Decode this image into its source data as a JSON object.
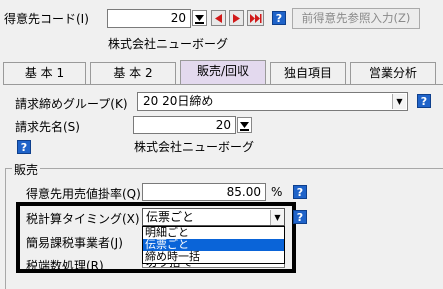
{
  "customer_code": {
    "label": "得意先コード(I)",
    "value": "20",
    "ref_button": "前得意先参照入力(Z)"
  },
  "customer_name": "株式会社ニューボーグ",
  "tabs": [
    {
      "label": "基 本 1"
    },
    {
      "label": "基 本 2"
    },
    {
      "label": "販売/回収"
    },
    {
      "label": "独自項目"
    },
    {
      "label": "営業分析"
    }
  ],
  "billing": {
    "group_label": "請求締めグループ(K)",
    "group_value": "20 20日締め",
    "dest_label": "請求先名(S)",
    "dest_code": "20",
    "dest_name": "株式会社ニューボーグ"
  },
  "sales": {
    "section_title": "販売",
    "rate_label": "得意先用売値掛率(Q)",
    "rate_value": "85.00",
    "rate_unit": "%",
    "tax_timing_label": "税計算タイミング(X)",
    "tax_timing_value": "伝票ごと",
    "tax_timing_options": [
      "明細ごと",
      "伝票ごと",
      "締め時一括"
    ],
    "simple_tax_label": "簡易課税事業者(J)",
    "rounding_label": "税端数処理(R)",
    "rounding_value_partial": "切り捨て"
  },
  "help_glyph": "?",
  "colors": {
    "selection": "#0a64d8",
    "active_tab": "#e3d9ee",
    "help": "#1f63c9",
    "arrow_red": "#d11a1a",
    "highlight_border": "#000000"
  }
}
